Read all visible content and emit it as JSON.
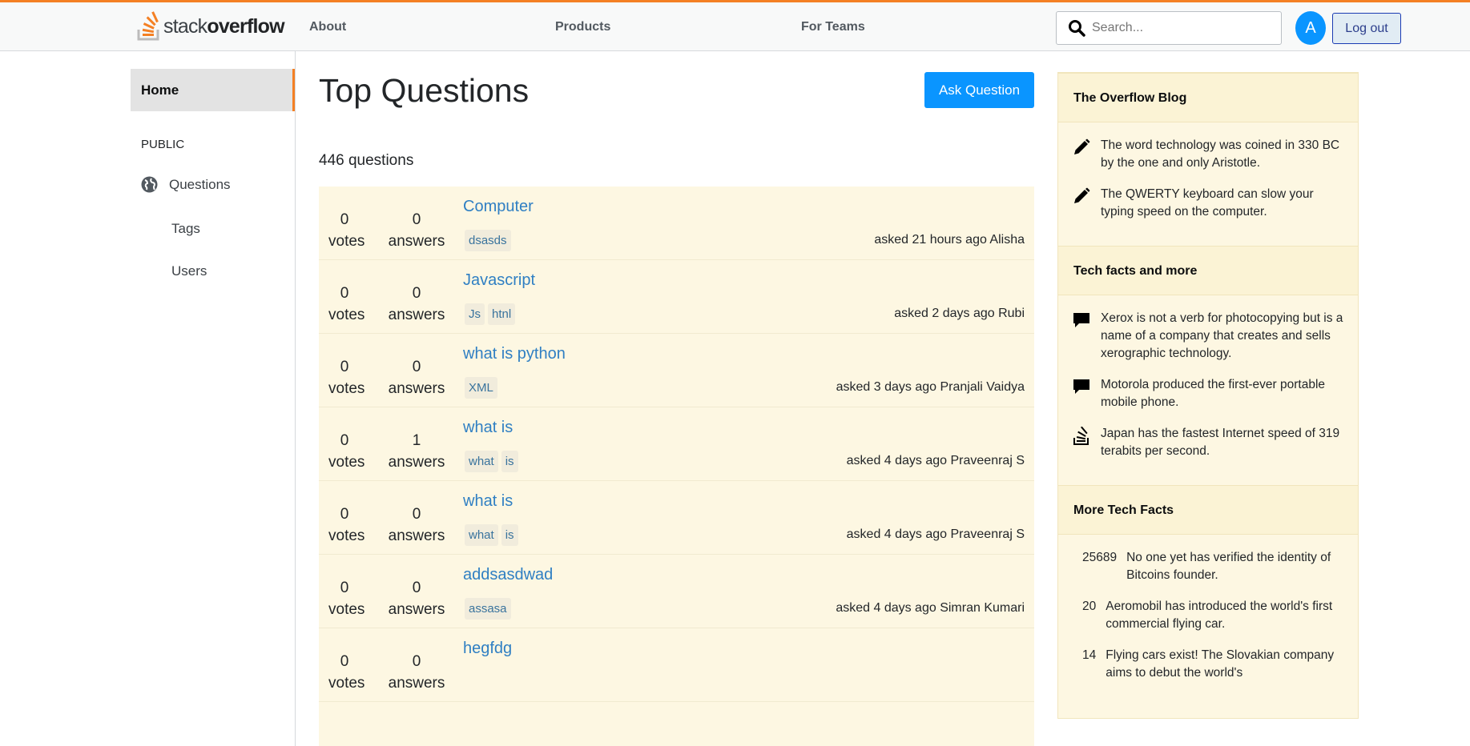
{
  "header": {
    "logo_word_light": "stack",
    "logo_word_bold": "overflow",
    "nav": [
      "About",
      "Products",
      "For Teams"
    ],
    "search_placeholder": "Search...",
    "avatar_initial": "A",
    "logout_label": "Log out"
  },
  "sidebar": {
    "home_label": "Home",
    "section_label": "PUBLIC",
    "items": [
      {
        "label": "Questions",
        "icon": "globe-icon"
      },
      {
        "label": "Tags"
      },
      {
        "label": "Users"
      }
    ]
  },
  "main": {
    "title": "Top Questions",
    "ask_button": "Ask Question",
    "count_text": "446 questions",
    "questions": [
      {
        "votes": "0",
        "votes_label": "votes",
        "answers": "0",
        "answers_label": "answers",
        "title": "Computer",
        "tags": [
          "dsasds"
        ],
        "asked": "asked 21 hours ago Alisha"
      },
      {
        "votes": "0",
        "votes_label": "votes",
        "answers": "0",
        "answers_label": "answers",
        "title": "Javascript",
        "tags": [
          "Js",
          "htnl"
        ],
        "asked": "asked 2 days ago Rubi"
      },
      {
        "votes": "0",
        "votes_label": "votes",
        "answers": "0",
        "answers_label": "answers",
        "title": "what is python",
        "tags": [
          "XML"
        ],
        "asked": "asked 3 days ago Pranjali Vaidya"
      },
      {
        "votes": "0",
        "votes_label": "votes",
        "answers": "1",
        "answers_label": "answers",
        "title": "what is",
        "tags": [
          "what",
          "is"
        ],
        "asked": "asked 4 days ago Praveenraj S"
      },
      {
        "votes": "0",
        "votes_label": "votes",
        "answers": "0",
        "answers_label": "answers",
        "title": "what is",
        "tags": [
          "what",
          "is"
        ],
        "asked": "asked 4 days ago Praveenraj S"
      },
      {
        "votes": "0",
        "votes_label": "votes",
        "answers": "0",
        "answers_label": "answers",
        "title": "addsasdwad",
        "tags": [
          "assasa"
        ],
        "asked": "asked 4 days ago Simran Kumari"
      },
      {
        "votes": "0",
        "votes_label": "votes",
        "answers": "0",
        "answers_label": "answers",
        "title": "hegfdg",
        "tags": [],
        "asked": ""
      }
    ]
  },
  "right": {
    "blog_title": "The Overflow Blog",
    "blog_items": [
      {
        "icon": "pencil-icon",
        "text": "The word technology was coined in 330 BC by the one and only Aristotle."
      },
      {
        "icon": "pencil-icon",
        "text": "The QWERTY keyboard can slow your typing speed on the computer."
      }
    ],
    "tech_title": "Tech facts and more",
    "tech_items": [
      {
        "icon": "comment-icon",
        "text": "Xerox is not a verb for photocopying but is a name of a company that creates and sells xerographic technology."
      },
      {
        "icon": "comment-icon",
        "text": "Motorola produced the first-ever portable mobile phone."
      },
      {
        "icon": "stack-exchange-icon",
        "text": "Japan has the fastest Internet speed of 319 terabits per second."
      }
    ],
    "more_title": "More Tech Facts",
    "more_items": [
      {
        "num": "25689",
        "text": "No one yet has verified the identity of Bitcoins founder."
      },
      {
        "num": "20",
        "text": "Aeromobil has introduced the world's first commercial flying car."
      },
      {
        "num": "14",
        "text": "Flying cars exist! The Slovakian company aims to debut the world's"
      }
    ]
  },
  "colors": {
    "accent": "#f48024",
    "primary": "#0a95ff",
    "link": "#2f7fc3",
    "panel": "#fdf7e2"
  }
}
